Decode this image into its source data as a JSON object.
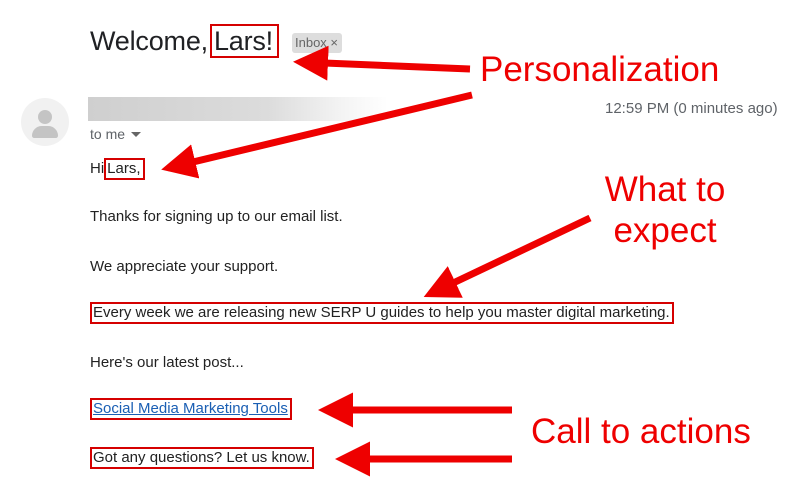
{
  "email": {
    "subject_prefix": "Welcome,",
    "subject_name": "Lars!",
    "inbox_badge": "Inbox ×",
    "timestamp": "12:59 PM (0 minutes ago)",
    "to_me": "to me",
    "body": {
      "greeting_prefix": "Hi",
      "greeting_name": "Lars,",
      "line1": "Thanks for signing up to our email list.",
      "line2": "We appreciate your support.",
      "line3": "Every week we are releasing new SERP U guides to help you master digital marketing.",
      "line4": "Here's our latest post...",
      "link": "Social Media Marketing Tools",
      "closing": "Got any questions? Let us know."
    }
  },
  "annotations": {
    "personalization": "Personalization",
    "what_to_expect_line1": "What to",
    "what_to_expect_line2": "expect",
    "call_to_actions": "Call to actions"
  },
  "colors": {
    "annotation_red": "#ee0000",
    "box_red": "#d50000",
    "link_blue": "#1a5fb4"
  }
}
